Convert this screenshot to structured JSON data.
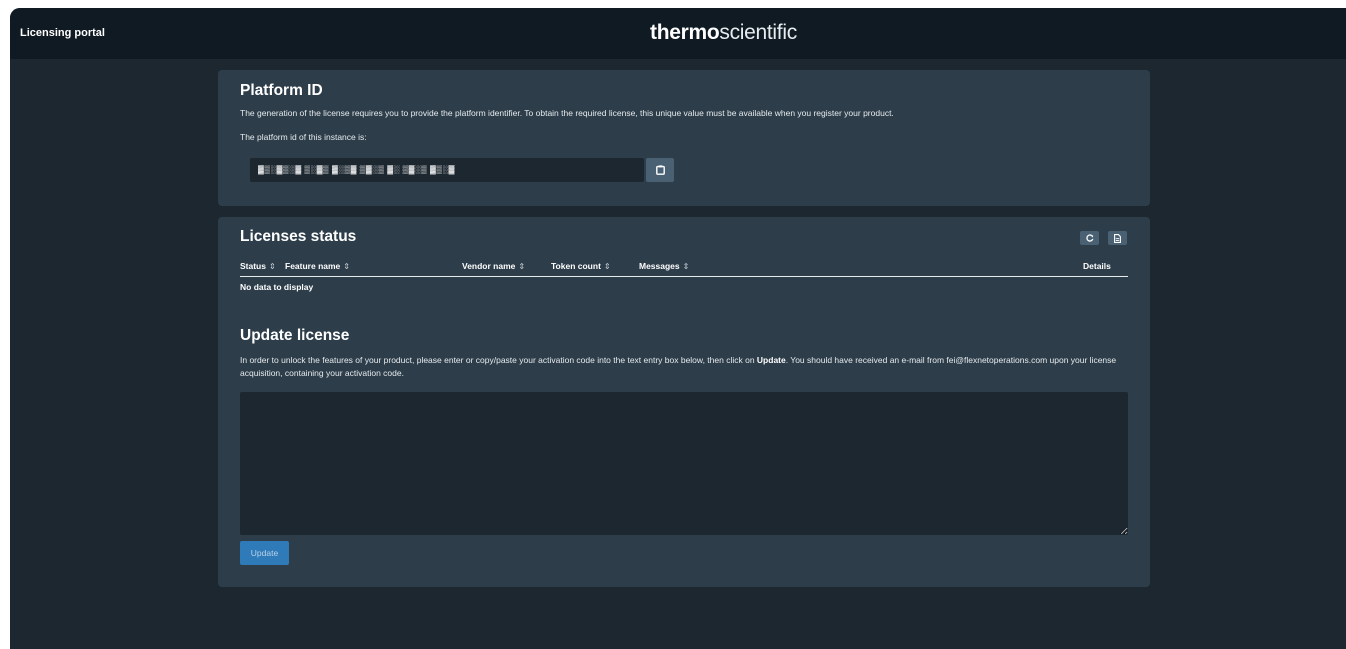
{
  "header": {
    "portal_title": "Licensing portal",
    "logo_bold": "thermo",
    "logo_light": "scientific"
  },
  "platform": {
    "title": "Platform ID",
    "description": "The generation of the license requires you to provide the platform identifier. To obtain the required license, this unique value must be available when you register your product.",
    "instance_label": "The platform id of this instance is:",
    "platform_id_value": "▓▒░▓▒░▓ ▒░▓▒ ▓░▒▓ ▒▓░▒ ▓░ ▒▓░▒ ▓▒░▓",
    "copy_icon": "clipboard-icon"
  },
  "licenses": {
    "title": "Licenses status",
    "refresh_icon": "refresh-icon",
    "export_icon": "file-icon",
    "columns": [
      "Status",
      "Feature name",
      "Vendor name",
      "Token count",
      "Messages",
      "Details"
    ],
    "sort_glyph": "⇕",
    "empty_text": "No data to display"
  },
  "update": {
    "title": "Update license",
    "desc_part1": "In order to unlock the features of your product, please enter or copy/paste your activation code into the text entry box below, then click on ",
    "desc_bold": "Update",
    "desc_part2": ". You should have received an e-mail from fei@flexnetoperations.com upon your license acquisition, containing your activation code.",
    "textarea_value": "",
    "button_label": "Update"
  },
  "colors": {
    "background": "#1c2730",
    "topbar": "#0f1a22",
    "card": "#2d3d4a",
    "button": "#4a6174",
    "primary": "#2f7ab8"
  }
}
